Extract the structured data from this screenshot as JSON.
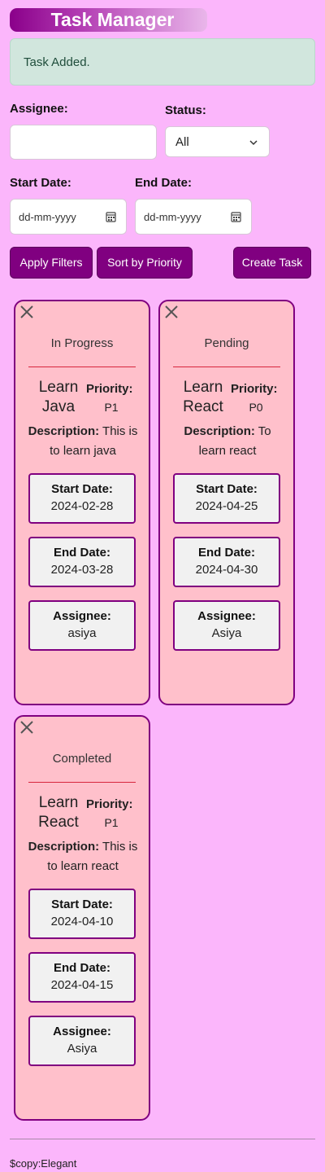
{
  "app": {
    "title": "Task Manager"
  },
  "alert": {
    "message": "Task Added."
  },
  "filters": {
    "assignee_label": "Assignee:",
    "assignee_value": "",
    "status_label": "Status:",
    "status_value": "All",
    "start_date_label": "Start Date:",
    "start_date_placeholder": "dd-mm-yyyy",
    "end_date_label": "End Date:",
    "end_date_placeholder": "dd-mm-yyyy"
  },
  "buttons": {
    "apply_filters": "Apply Filters",
    "sort_by_priority": "Sort by Priority",
    "create_task": "Create Task"
  },
  "tasks": [
    {
      "status": "In Progress",
      "name": "Learn Java",
      "priority_label": "Priority:",
      "priority": "P1",
      "description_label": "Description:",
      "description": "This is to learn java",
      "start_label": "Start Date:",
      "start_date": "2024-02-28",
      "end_label": "End Date:",
      "end_date": "2024-03-28",
      "assignee_label": "Assignee:",
      "assignee": "asiya"
    },
    {
      "status": "Pending",
      "name": "Learn React",
      "priority_label": "Priority:",
      "priority": "P0",
      "description_label": "Description:",
      "description": "To learn react",
      "start_label": "Start Date:",
      "start_date": "2024-04-25",
      "end_label": "End Date:",
      "end_date": "2024-04-30",
      "assignee_label": "Assignee:",
      "assignee": "Asiya"
    },
    {
      "status": "Completed",
      "name": "Learn React",
      "priority_label": "Priority:",
      "priority": "P1",
      "description_label": "Description:",
      "description": "This is to learn react",
      "start_label": "Start Date:",
      "start_date": "2024-04-10",
      "end_label": "End Date:",
      "end_date": "2024-04-15",
      "assignee_label": "Assignee:",
      "assignee": "Asiya"
    }
  ],
  "footer": {
    "text": "$copy:Elegant"
  },
  "colors": {
    "background": "#fbb6fb",
    "primary": "#800080",
    "card": "#ffc0cb",
    "alert_bg": "#d1e6dd"
  },
  "icons": {
    "close": "close-icon",
    "calendar": "calendar-icon",
    "chevron": "chevron-down-icon"
  }
}
